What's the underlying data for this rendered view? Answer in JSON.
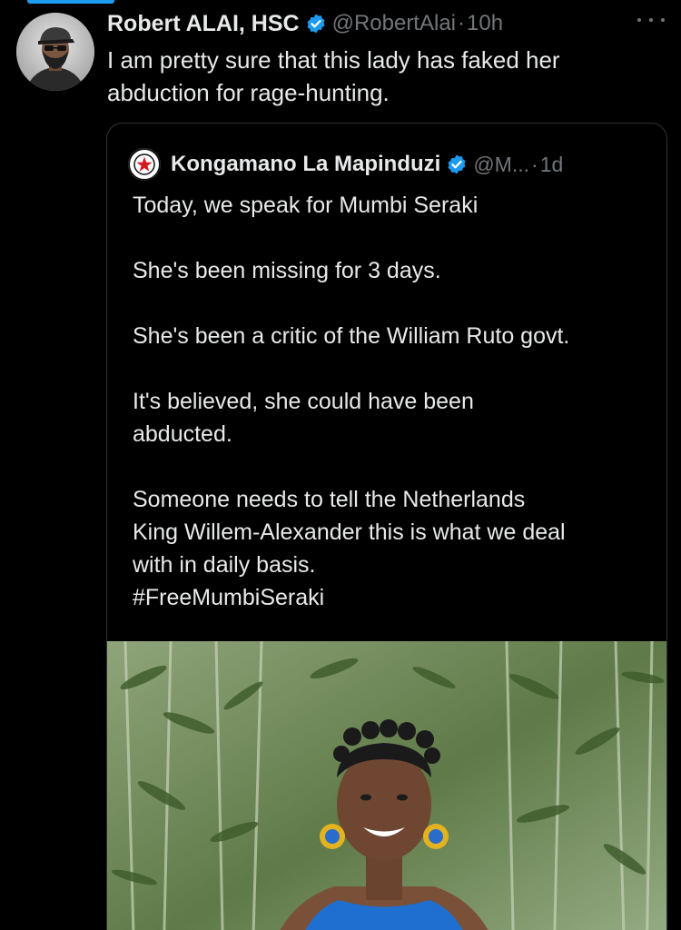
{
  "tweet": {
    "author_name": "Robert ALAI, HSC",
    "handle": "@RobertAlai",
    "separator": "·",
    "time": "10h",
    "text_line1": "I am pretty sure that this lady has faked her",
    "text_line2": "abduction for rage-hunting.",
    "avatar_icon": "user-avatar-sunglasses-cap",
    "more_icon": "more-horizontal-icon"
  },
  "quote": {
    "author_name": "Kongamano La Mapinduzi",
    "handle": "@M...",
    "separator": "·",
    "time": "1d",
    "avatar_icon": "kongamano-star-logo",
    "avatar_logo_text": "KONGAMANO LA MAPINDUZI",
    "lines": [
      "Today, we speak for Mumbi Seraki",
      "She's been missing for 3 days.",
      "She's been a critic of the William Ruto govt.",
      "It's believed, she could have been",
      "abducted.",
      "Someone needs to tell the Netherlands",
      "King Willem-Alexander this is what we deal",
      "with in daily basis.",
      "#FreeMumbiSeraki"
    ],
    "image": "photo-woman-smiling-blue-dress-bamboo-background"
  },
  "colors": {
    "background": "#000000",
    "text": "#e7e9ea",
    "muted": "#71767b",
    "verified": "#1d9bf0",
    "border": "#2f3336"
  }
}
